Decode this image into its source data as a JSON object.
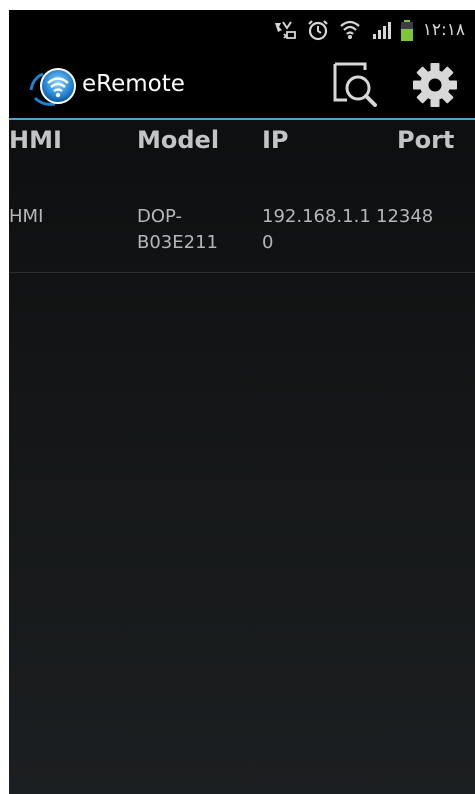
{
  "status_bar": {
    "time": "١٢:١٨",
    "icons": [
      "missed-call-icon",
      "alarm-icon",
      "wifi-icon",
      "signal-icon",
      "battery-icon"
    ]
  },
  "action_bar": {
    "title": "eRemote",
    "logo_icon": "eremote-logo-icon",
    "search_icon": "search-icon",
    "settings_icon": "gear-icon",
    "accent": "#4aa6cf"
  },
  "table": {
    "columns": [
      "HMI",
      "Model",
      "IP",
      "Port"
    ],
    "rows": [
      {
        "hmi": "HMI",
        "model_line1": "DOP-",
        "model_line2": "B03E211",
        "ip_line1": "192.168.1.1",
        "ip_line2": "0",
        "port": "12348"
      }
    ]
  }
}
